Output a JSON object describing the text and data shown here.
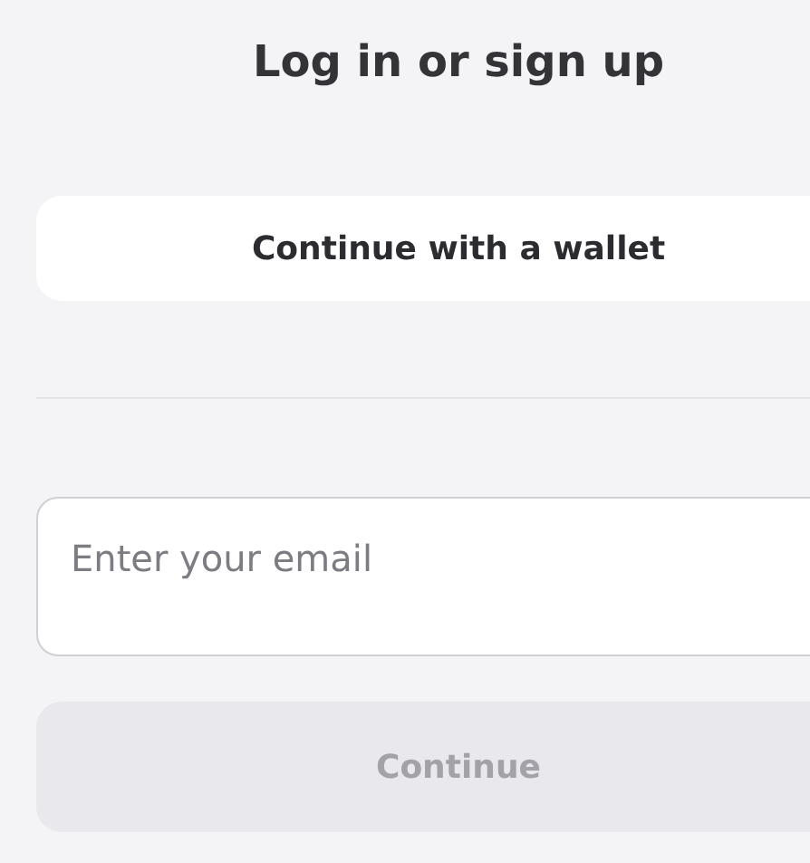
{
  "title": "Log in or sign up",
  "wallet_button": {
    "label": "Continue with a wallet"
  },
  "email_field": {
    "placeholder": "Enter your email"
  },
  "continue_button": {
    "label": "Continue",
    "disabled": true
  }
}
